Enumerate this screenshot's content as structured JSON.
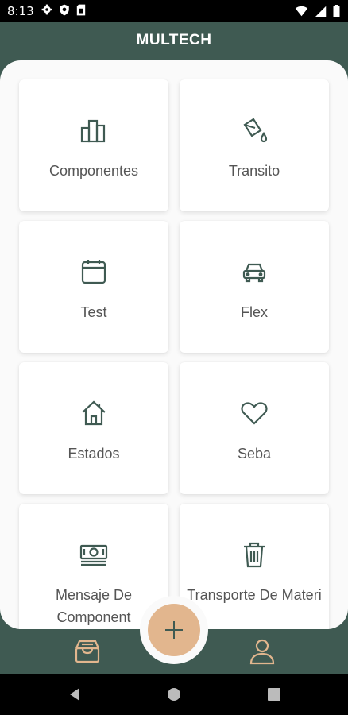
{
  "status_bar": {
    "time": "8:13",
    "left_icons": [
      "gear-icon",
      "shield-icon",
      "sim-card-icon"
    ],
    "right_icons": [
      "wifi-icon",
      "signal-icon",
      "battery-icon"
    ]
  },
  "header": {
    "title": "MULTECH"
  },
  "colors": {
    "brand_green": "#3f5a52",
    "accent": "#e2b68e",
    "card_bg": "#ffffff",
    "icon": "#3f5a52",
    "label": "#555555"
  },
  "grid": {
    "items": [
      {
        "label": "Componentes",
        "icon": "building-icon"
      },
      {
        "label": "Transito",
        "icon": "paint-bucket-icon"
      },
      {
        "label": "Test",
        "icon": "calendar-icon"
      },
      {
        "label": "Flex",
        "icon": "car-icon"
      },
      {
        "label": "Estados",
        "icon": "home-icon"
      },
      {
        "label": "Seba",
        "icon": "heart-icon"
      },
      {
        "label": "Mensaje De Component",
        "icon": "money-icon"
      },
      {
        "label": "Transporte De Materi",
        "icon": "trash-icon"
      }
    ]
  },
  "bottom_nav": {
    "left_icon": "inbox-icon",
    "fab_icon": "plus-icon",
    "right_icon": "user-icon"
  },
  "android_nav": [
    "back-icon",
    "home-circle-icon",
    "recents-icon"
  ]
}
